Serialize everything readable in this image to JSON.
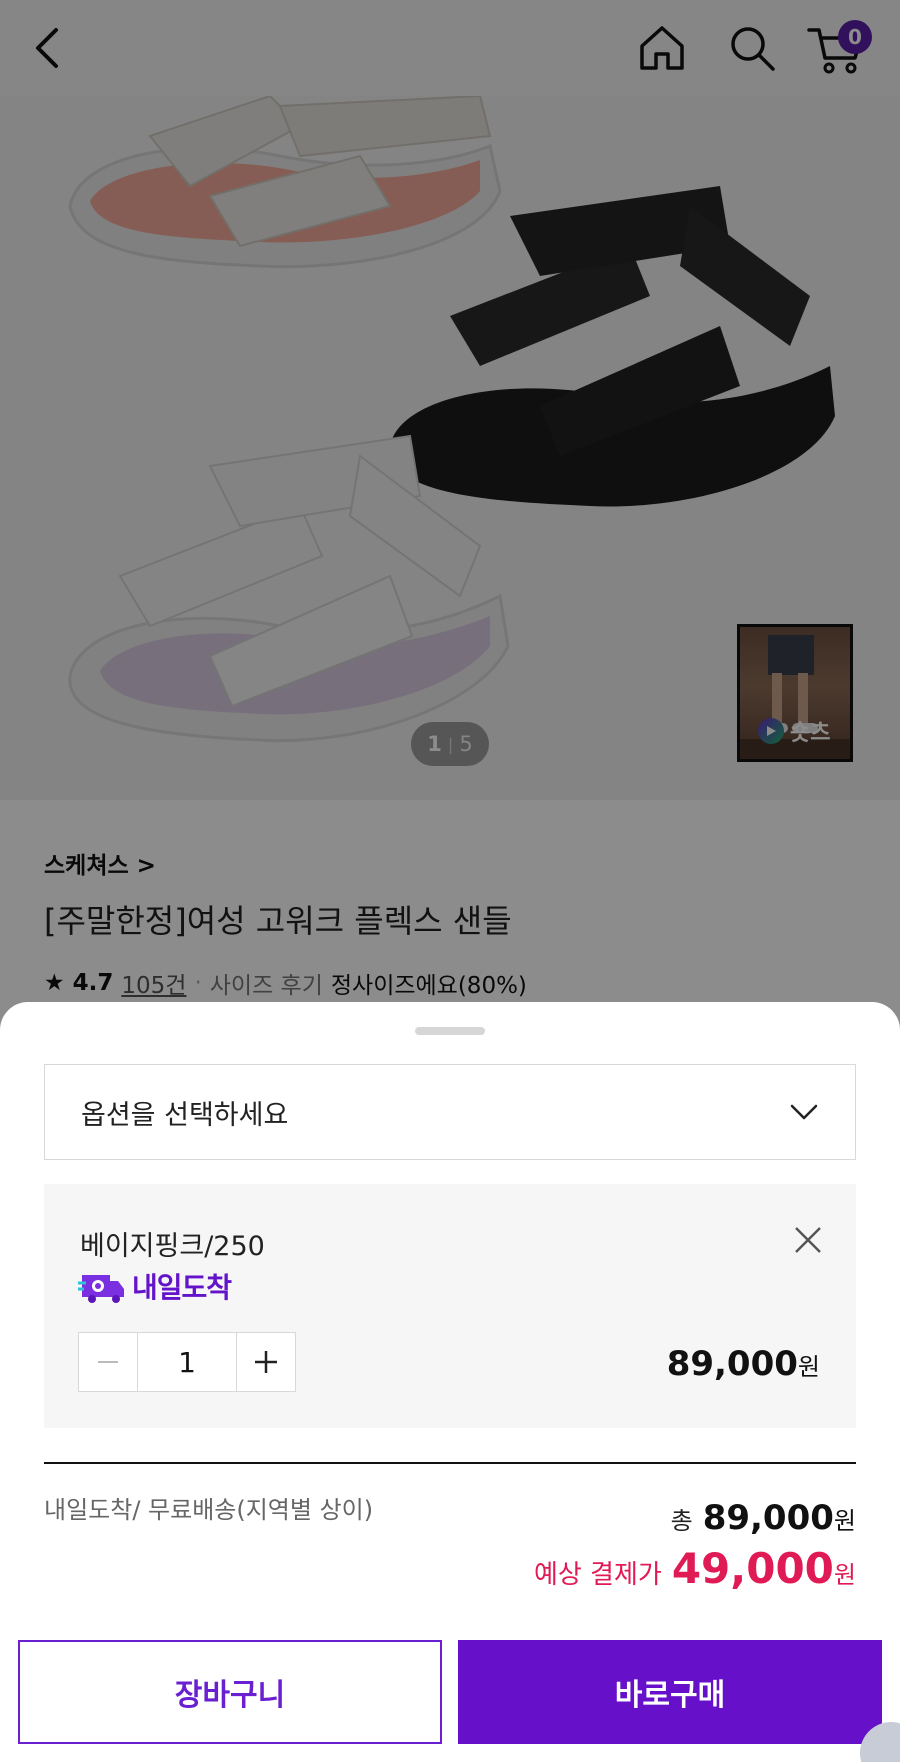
{
  "header": {
    "back_icon": "chevron-left-icon",
    "home_icon": "home-icon",
    "search_icon": "search-icon",
    "cart_icon": "cart-icon",
    "cart_count": "0"
  },
  "gallery": {
    "current": "1",
    "separator": "|",
    "total": "5",
    "shorts_label": "숏츠"
  },
  "product": {
    "brand": "스케쳐스 >",
    "title": "[주말한정]여성 고워크 플렉스 샌들",
    "rating": "4.7",
    "review_count": "105건",
    "size_review_label": "사이즈 후기",
    "size_review_value": "정사이즈에요(80%)"
  },
  "sheet": {
    "select_placeholder": "옵션을 선택하세요",
    "option": {
      "name": "베이지핑크/250",
      "delivery_badge": "내일도착",
      "quantity": "1",
      "price": "89,000",
      "price_unit": "원"
    },
    "shipping_info": "내일도착/ 무료배송(지역별 상이)",
    "total_label": "총",
    "total_value": "89,000",
    "total_unit": "원",
    "expected_label": "예상 결제가",
    "expected_value": "49,000",
    "expected_unit": "원",
    "cart_button": "장바구니",
    "buy_button": "바로구매"
  },
  "colors": {
    "accent": "#6710c9",
    "price_highlight": "#e01a55"
  }
}
